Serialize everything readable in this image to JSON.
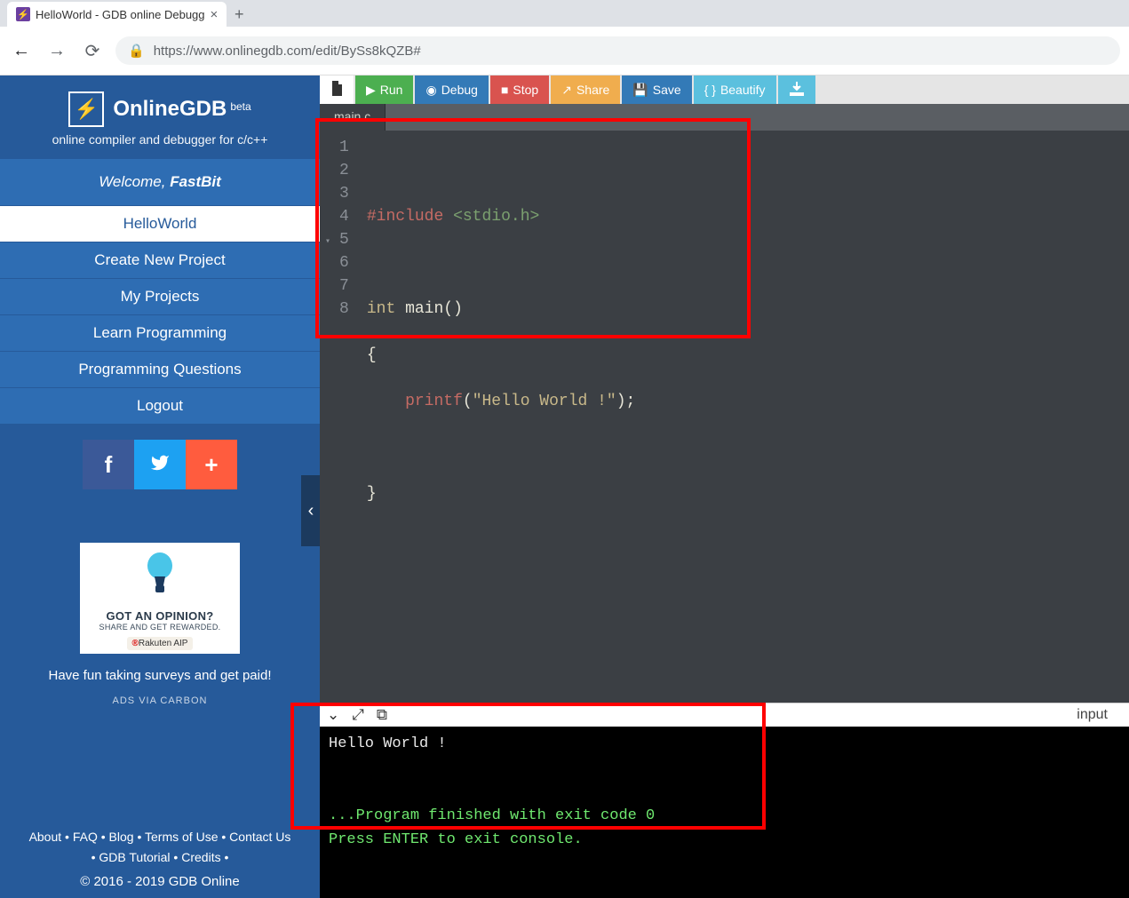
{
  "browser": {
    "tab_title": "HelloWorld - GDB online Debugg",
    "url": "https://www.onlinegdb.com/edit/BySs8kQZB#"
  },
  "brand": {
    "name": "OnlineGDB",
    "badge": "beta",
    "tagline": "online compiler and debugger for c/c++"
  },
  "welcome": {
    "prefix": "Welcome, ",
    "user": "FastBit"
  },
  "sidebar": {
    "items": [
      {
        "label": "HelloWorld",
        "active": true
      },
      {
        "label": "Create New Project",
        "active": false
      },
      {
        "label": "My Projects",
        "active": false
      },
      {
        "label": "Learn Programming",
        "active": false
      },
      {
        "label": "Programming Questions",
        "active": false
      },
      {
        "label": "Logout",
        "active": false
      }
    ]
  },
  "ad": {
    "headline": "GOT AN OPINION?",
    "sub": "SHARE AND GET REWARDED.",
    "pill_prefix": "®",
    "pill_text": "Rakuten AIP",
    "text": "Have fun taking surveys and get paid!",
    "ads_via": "ADS VIA CARBON"
  },
  "footer": {
    "links": [
      "About",
      "FAQ",
      "Blog",
      "Terms of Use",
      "Contact Us",
      "GDB Tutorial",
      "Credits"
    ],
    "copyright": "© 2016 - 2019 GDB Online"
  },
  "toolbar": {
    "run": "Run",
    "debug": "Debug",
    "stop": "Stop",
    "share": "Share",
    "save": "Save",
    "beautify": "Beautify"
  },
  "file_tab": "main.c",
  "code": {
    "lines": [
      {
        "n": 1,
        "raw": ""
      },
      {
        "n": 2,
        "raw": "#include <stdio.h>"
      },
      {
        "n": 3,
        "raw": ""
      },
      {
        "n": 4,
        "raw": "int main()"
      },
      {
        "n": 5,
        "raw": "{"
      },
      {
        "n": 6,
        "raw": "    printf(\"Hello World !\");"
      },
      {
        "n": 7,
        "raw": ""
      },
      {
        "n": 8,
        "raw": "}"
      }
    ]
  },
  "console": {
    "input_label": "input",
    "output_line": "Hello World !",
    "status_line1": "...Program finished with exit code 0",
    "status_line2": "Press ENTER to exit console."
  }
}
